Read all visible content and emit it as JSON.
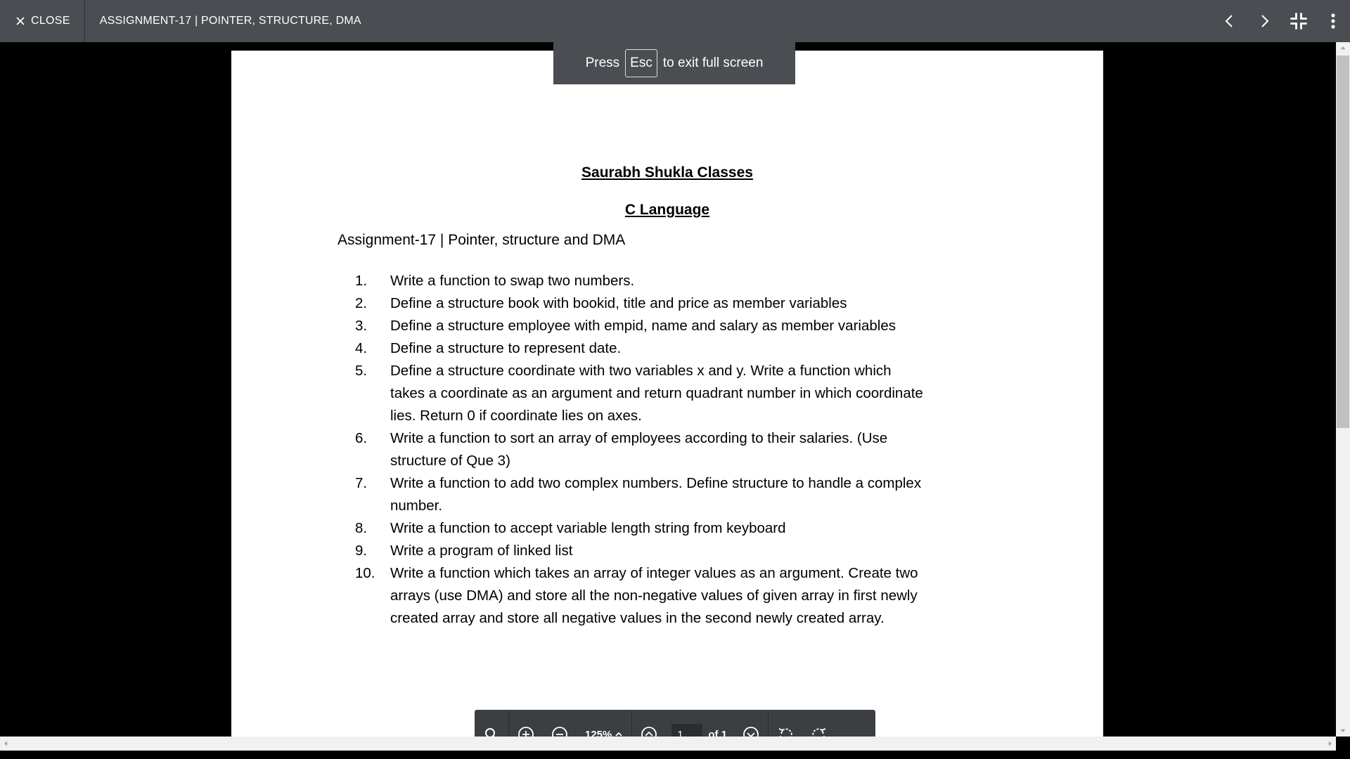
{
  "topbar": {
    "close_label": "CLOSE",
    "title": "ASSIGNMENT-17 | POINTER, STRUCTURE, DMA",
    "actions": [
      "chevron-left-icon",
      "chevron-right-icon",
      "exit-fullscreen-icon",
      "more-vert-icon"
    ]
  },
  "toast": {
    "prefix": "Press",
    "key": "Esc",
    "suffix": "to exit full screen"
  },
  "document": {
    "heading1": "Saurabh Shukla Classes",
    "heading2": "C Language",
    "subtitle": "Assignment-17 | Pointer, structure and DMA",
    "questions": [
      {
        "num": "1.",
        "text": "Write a function to swap two numbers."
      },
      {
        "num": "2.",
        "text": "Define a structure book with bookid, title and price as member variables"
      },
      {
        "num": "3.",
        "text": "Define a structure employee with empid, name and salary as member variables"
      },
      {
        "num": "4.",
        "text": "Define a structure to represent date."
      },
      {
        "num": "5.",
        "text": "Define a structure coordinate with two variables x and y. Write a function which takes a coordinate as an argument and return quadrant number in which coordinate lies. Return 0 if coordinate lies on axes."
      },
      {
        "num": "6.",
        "text": "Write a function to sort an array of employees according to their salaries. (Use structure  of Que 3)"
      },
      {
        "num": "7.",
        "text": "Write a function to add two complex numbers. Define structure to handle a complex number."
      },
      {
        "num": "8.",
        "text": "Write a function to accept variable length string from keyboard"
      },
      {
        "num": "9.",
        "text": "Write a program of linked list"
      },
      {
        "num": "10.",
        "text": "Write a function which takes an array of integer values as an argument. Create two arrays (use DMA) and store all the non-negative values of given array in first newly created array and store all negative values in the second newly created array."
      }
    ]
  },
  "pdf_toolbar": {
    "zoom": "125%",
    "page_current": "1",
    "page_total_label": "of 1"
  }
}
